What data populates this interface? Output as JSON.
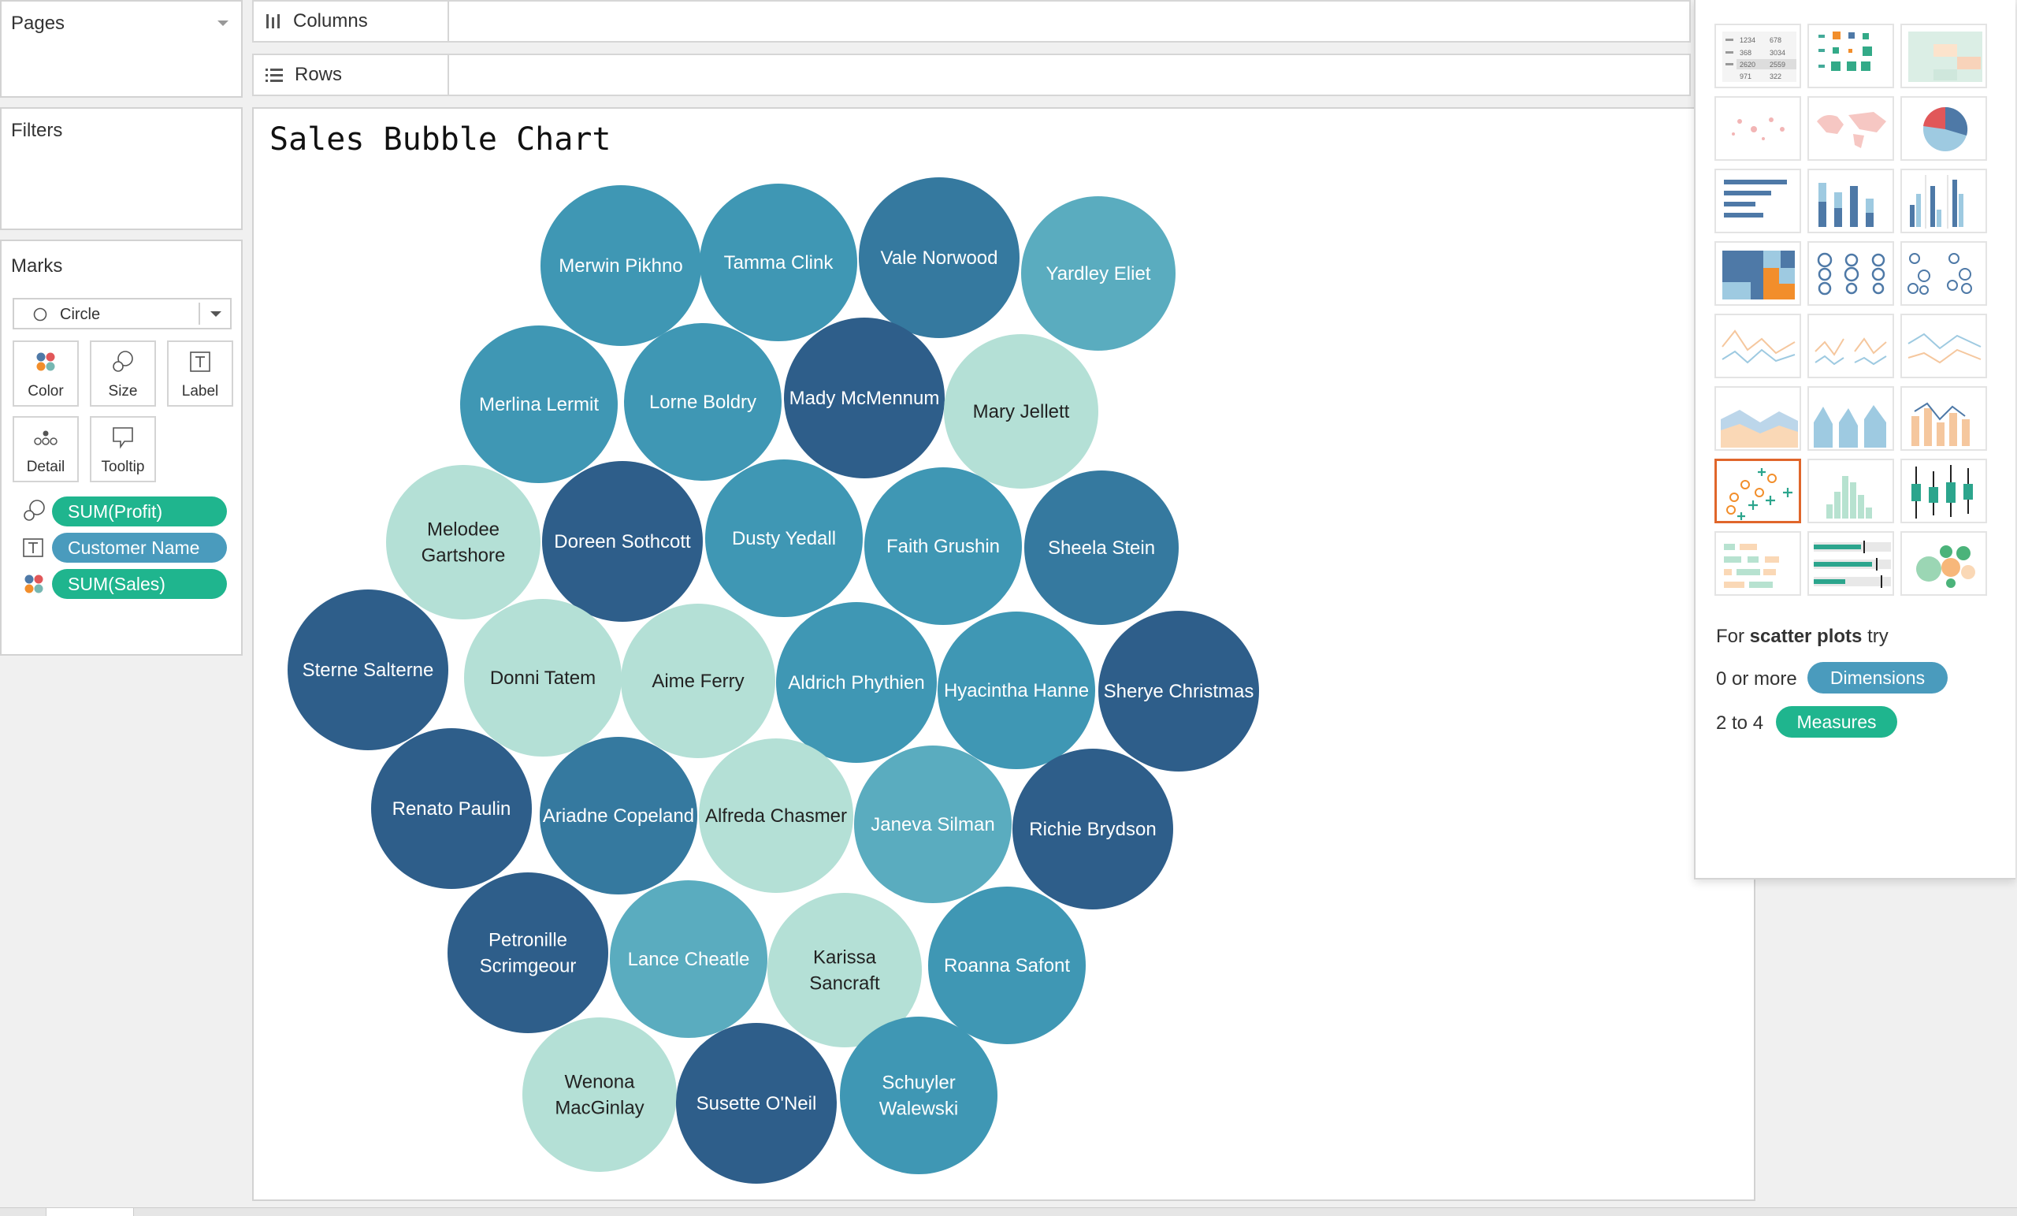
{
  "pages": {
    "title": "Pages"
  },
  "filters": {
    "title": "Filters"
  },
  "marks": {
    "title": "Marks",
    "mark_type": "Circle",
    "buttons": [
      "Color",
      "Size",
      "Label",
      "Detail",
      "Tooltip"
    ],
    "pills": [
      {
        "label": "SUM(Profit)",
        "icon": "size-icon",
        "color": "#1fb58e"
      },
      {
        "label": "Customer Name",
        "icon": "label-icon",
        "color": "#4a9bbd"
      },
      {
        "label": "SUM(Sales)",
        "icon": "color-icon",
        "color": "#1fb58e"
      }
    ]
  },
  "shelves": {
    "columns": "Columns",
    "rows": "Rows"
  },
  "view": {
    "title": "Sales Bubble Chart"
  },
  "chart_data": {
    "type": "bubble",
    "title": "Sales Bubble Chart",
    "encoding": {
      "size": "SUM(Profit)",
      "label": "Customer Name",
      "color": "SUM(Sales)"
    },
    "colors": [
      "#b4e0d6",
      "#5aacbf",
      "#3f97b4",
      "#35799f",
      "#2e5e8a"
    ],
    "bubbles": [
      {
        "name": "Merwin Pikhno",
        "color_level": 2
      },
      {
        "name": "Tamma Clink",
        "color_level": 2
      },
      {
        "name": "Vale Norwood",
        "color_level": 3
      },
      {
        "name": "Yardley Eliet",
        "color_level": 1
      },
      {
        "name": "Merlina Lermit",
        "color_level": 2
      },
      {
        "name": "Lorne Boldry",
        "color_level": 2
      },
      {
        "name": "Mady McMennum",
        "color_level": 4
      },
      {
        "name": "Mary Jellett",
        "color_level": 0
      },
      {
        "name": "Melodee Gartshore",
        "color_level": 0
      },
      {
        "name": "Doreen Sothcott",
        "color_level": 4
      },
      {
        "name": "Dusty Yedall",
        "color_level": 2
      },
      {
        "name": "Faith Grushin",
        "color_level": 2
      },
      {
        "name": "Sheela Stein",
        "color_level": 3
      },
      {
        "name": "Sterne Salterne",
        "color_level": 4
      },
      {
        "name": "Donni Tatem",
        "color_level": 0
      },
      {
        "name": "Aime Ferry",
        "color_level": 0
      },
      {
        "name": "Aldrich Phythien",
        "color_level": 2
      },
      {
        "name": "Hyacintha Hanne",
        "color_level": 2
      },
      {
        "name": "Sherye Christmas",
        "color_level": 4
      },
      {
        "name": "Renato Paulin",
        "color_level": 4
      },
      {
        "name": "Ariadne Copeland",
        "color_level": 3
      },
      {
        "name": "Alfreda Chasmer",
        "color_level": 0
      },
      {
        "name": "Janeva Silman",
        "color_level": 1
      },
      {
        "name": "Richie Brydson",
        "color_level": 4
      },
      {
        "name": "Petronille Scrimgeour",
        "color_level": 4
      },
      {
        "name": "Lance Cheatle",
        "color_level": 1
      },
      {
        "name": "Karissa Sancraft",
        "color_level": 0
      },
      {
        "name": "Roanna Safont",
        "color_level": 2
      },
      {
        "name": "Wenona MacGinlay",
        "color_level": 0
      },
      {
        "name": "Susette O'Neil",
        "color_level": 4
      },
      {
        "name": "Schuyler Walewski",
        "color_level": 2
      }
    ]
  },
  "show_me": {
    "hint_for": "For",
    "hint_type": "scatter plots",
    "hint_try": "try",
    "dimensions_prefix": "0 or more",
    "dimensions_label": "Dimensions",
    "measures_prefix": "2 to 4",
    "measures_label": "Measures",
    "selected_chart": "scatter-plot",
    "table_numbers": [
      "1234",
      "678",
      "368",
      "3034",
      "2620",
      "2559",
      "971",
      "322"
    ]
  },
  "colors": {
    "measure_green": "#1fb58e",
    "dimension_blue": "#4a9bbd",
    "selected_orange": "#e0662b"
  }
}
